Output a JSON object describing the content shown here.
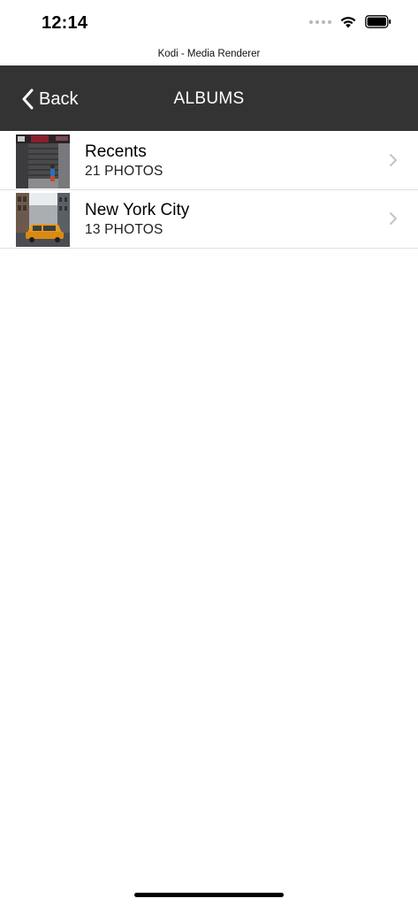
{
  "status_bar": {
    "time": "12:14"
  },
  "app_caption": "Kodi - Media Renderer",
  "nav": {
    "back_label": "Back",
    "title": "ALBUMS"
  },
  "albums": [
    {
      "name": "Recents",
      "count": "21 PHOTOS"
    },
    {
      "name": "New York City",
      "count": "13 PHOTOS"
    }
  ],
  "icons": {
    "back": "chevron-left-icon",
    "row": "chevron-right-icon",
    "wifi": "wifi-icon",
    "battery": "battery-icon"
  },
  "colors": {
    "nav_background": "#333333",
    "nav_text": "#ffffff",
    "separator": "#e0e0e0",
    "chevron": "#c4c4c4"
  }
}
